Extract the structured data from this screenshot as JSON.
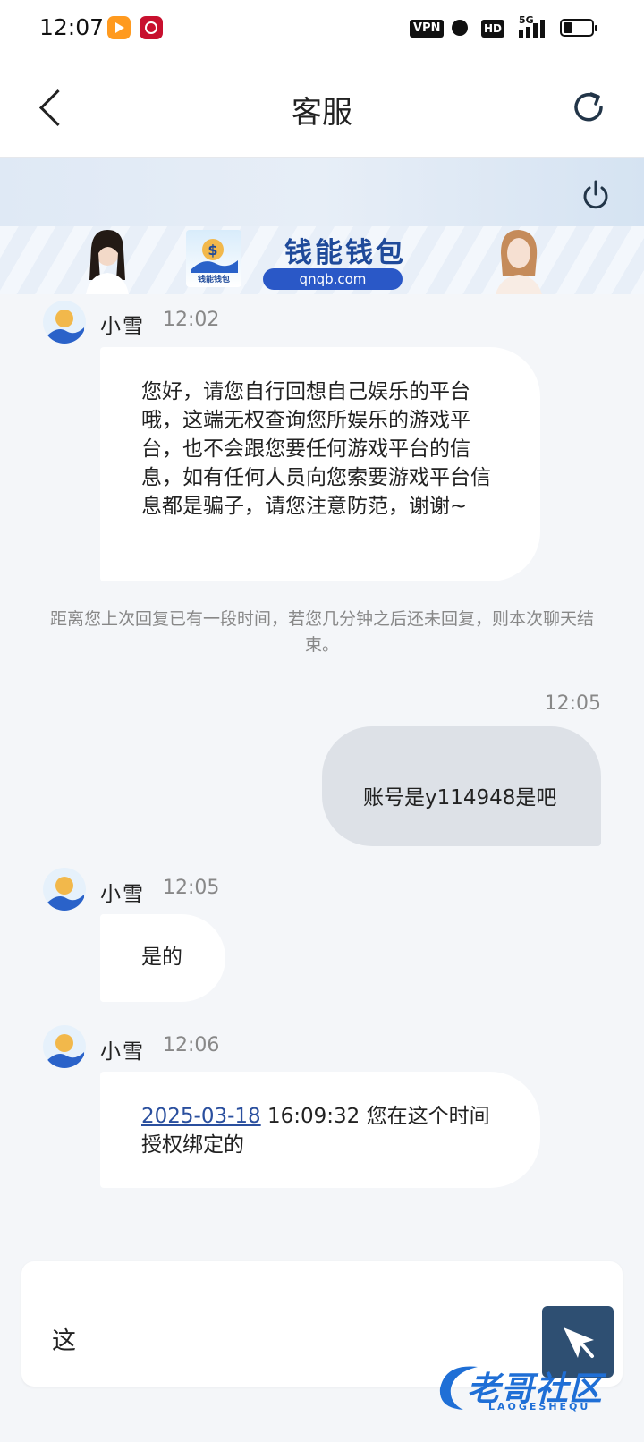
{
  "status_bar": {
    "time": "12:07",
    "vpn": "VPN",
    "hd": "HD",
    "network": "5G"
  },
  "header": {
    "title": "客服",
    "back_icon": "chevron-left-icon",
    "refresh_icon": "refresh-icon"
  },
  "banner": {
    "brand_name": "钱能钱包",
    "brand_url": "qnqb.com",
    "logo_text": "钱能钱包"
  },
  "messages": [
    {
      "sender": "小雪",
      "time": "12:02",
      "text": "您好，请您自行回想自己娱乐的平台哦，这端无权查询您所娱乐的游戏平台，也不会跟您要任何游戏平台的信息，如有任何人员向您索要游戏平台信息都是骗子，请您注意防范，谢谢~"
    },
    {
      "system": "距离您上次回复已有一段时间，若您几分钟之后还未回复，则本次聊天结束。"
    },
    {
      "outgoing": true,
      "time": "12:05",
      "text": "账号是y114948是吧"
    },
    {
      "sender": "小雪",
      "time": "12:05",
      "text": "是的"
    },
    {
      "sender": "小雪",
      "time": "12:06",
      "link_text": "2025-03-18",
      "text": " 16:09:32 您在这个时间授权绑定的"
    }
  ],
  "input": {
    "value": "这",
    "send_icon": "send-icon"
  },
  "watermark": {
    "text": "老哥社区",
    "sub": "LAOGESHEQU"
  },
  "colors": {
    "background": "#f4f6f9",
    "outgoing_bubble": "#dde1e7",
    "send_button": "#2e4f72",
    "link": "#2a4f9e"
  }
}
